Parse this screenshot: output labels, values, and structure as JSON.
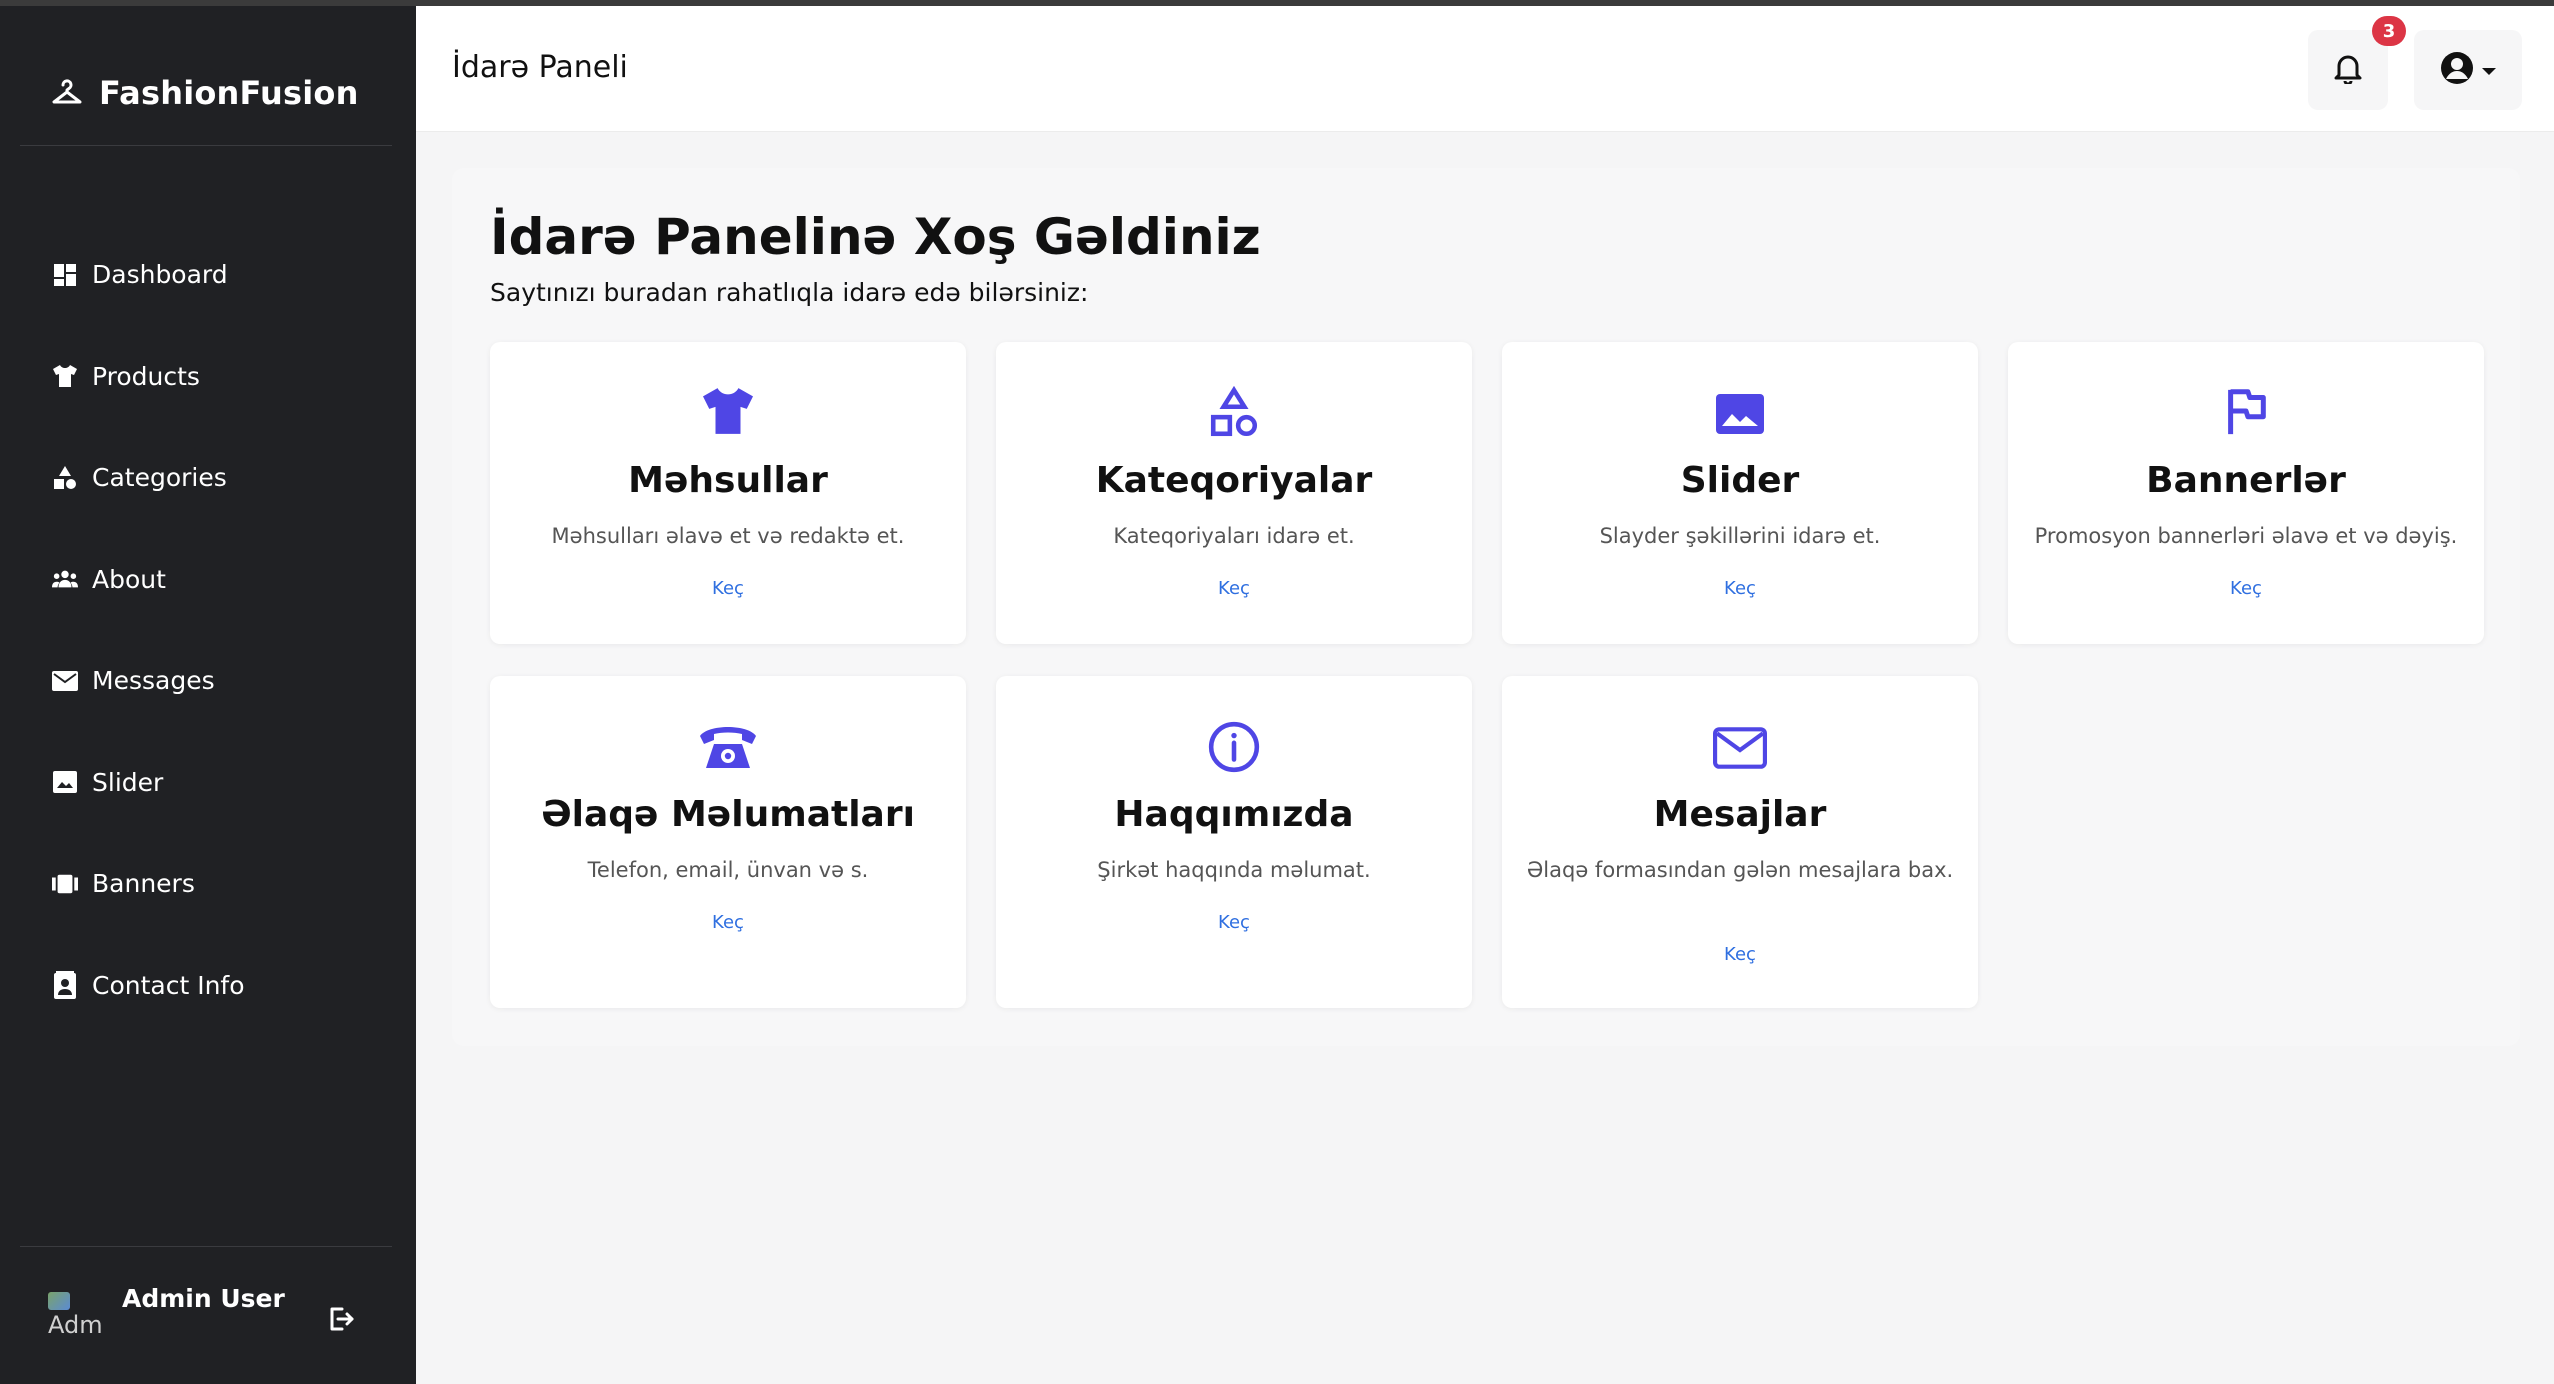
{
  "app": {
    "brand": "FashionFusion",
    "page_title": "İdarə Paneli",
    "notification_count": "3",
    "accent_color": "#4f46e5",
    "link_color": "#2f6fe0"
  },
  "sidebar": {
    "items": [
      {
        "label": "Dashboard",
        "icon": "dashboard-icon"
      },
      {
        "label": "Products",
        "icon": "tshirt-icon"
      },
      {
        "label": "Categories",
        "icon": "shapes-icon"
      },
      {
        "label": "About",
        "icon": "users-icon"
      },
      {
        "label": "Messages",
        "icon": "envelope-icon"
      },
      {
        "label": "Slider",
        "icon": "image-icon"
      },
      {
        "label": "Banners",
        "icon": "banner-icon"
      },
      {
        "label": "Contact Info",
        "icon": "contact-card-icon"
      }
    ],
    "user": {
      "name": "Admin User",
      "avatar_alt": "Adm"
    }
  },
  "main": {
    "title": "İdarə Panelinə Xoş Gəldiniz",
    "subtitle": "Saytınızı buradan rahatlıqla idarə edə bilərsiniz:",
    "cards": [
      {
        "title": "Məhsullar",
        "desc": "Məhsulları əlavə et və redaktə et.",
        "link": "Keç",
        "icon": "tshirt-icon"
      },
      {
        "title": "Kateqoriyalar",
        "desc": "Kateqoriyaları idarə et.",
        "link": "Keç",
        "icon": "shapes-icon"
      },
      {
        "title": "Slider",
        "desc": "Slayder şəkillərini idarə et.",
        "link": "Keç",
        "icon": "image-icon"
      },
      {
        "title": "Bannerlər",
        "desc": "Promosyon bannerləri əlavə et və dəyiş.",
        "link": "Keç",
        "icon": "flag-icon"
      },
      {
        "title": "Əlaqə Məlumatları",
        "desc": "Telefon, email, ünvan və s.",
        "link": "Keç",
        "icon": "phone-icon"
      },
      {
        "title": "Haqqımızda",
        "desc": "Şirkət haqqında məlumat.",
        "link": "Keç",
        "icon": "info-icon"
      },
      {
        "title": "Mesajlar",
        "desc": "Əlaqə formasından gələn mesajlara bax.",
        "link": "Keç",
        "icon": "envelope-icon"
      }
    ]
  }
}
